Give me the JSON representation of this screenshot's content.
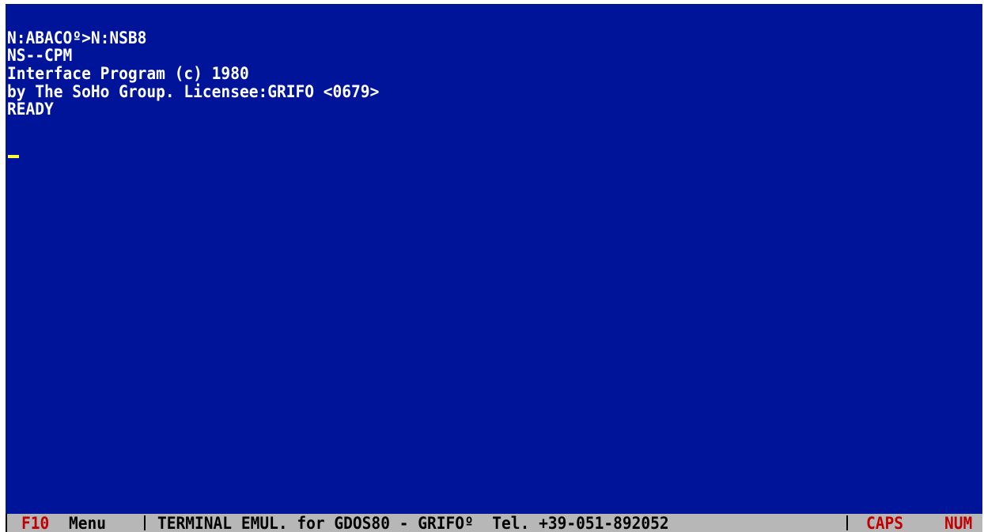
{
  "terminal": {
    "lines": [
      "N:ABACOº>N:NSB8",
      "NS--CPM",
      "Interface Program (c) 1980",
      "by The SoHo Group. Licensee:GRIFO <0679>",
      "READY"
    ]
  },
  "statusbar": {
    "menu_key": "F10",
    "menu_label": "Menu",
    "title": "TERMINAL EMUL. for GDOS80 - GRIFOº  Tel. +39-051-892052",
    "caps": "CAPS",
    "num": "NUM"
  },
  "colors": {
    "screen_background": "#00149a",
    "text": "#ffffff",
    "cursor": "#ffff40",
    "statusbar_background": "#b7b7b7",
    "statusbar_text": "#000000",
    "statusbar_accent": "#c00000"
  }
}
